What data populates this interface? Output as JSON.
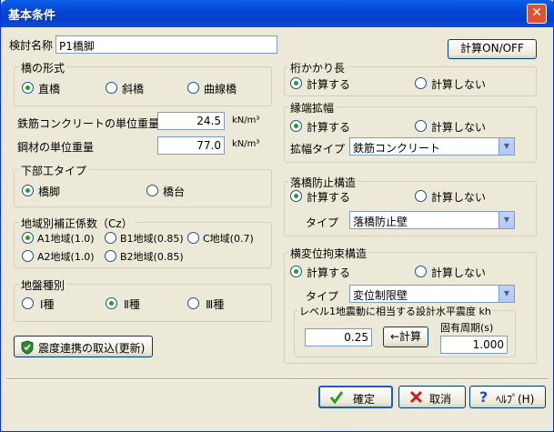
{
  "window": {
    "title": "基本条件",
    "close_glyph": "✕"
  },
  "kentou": {
    "label": "検討名称",
    "value": "P1橋脚"
  },
  "calc_toggle_button": "計算ON/OFF",
  "bridge_form": {
    "title": "橋の形式",
    "options": [
      {
        "label": "直橋",
        "selected": true
      },
      {
        "label": "斜橋",
        "selected": false
      },
      {
        "label": "曲線橋",
        "selected": false
      }
    ]
  },
  "rebar_concrete_weight": {
    "label": "鉄筋コンクリートの単位重量",
    "value": "24.5",
    "unit": "kN/m³"
  },
  "steel_weight": {
    "label": "鋼材の単位重量",
    "value": "77.0",
    "unit": "kN/m³"
  },
  "substructure": {
    "title": "下部工タイプ",
    "options": [
      {
        "label": "橋脚",
        "selected": true
      },
      {
        "label": "橋台",
        "selected": false
      }
    ]
  },
  "regional_coeff": {
    "title": "地域別補正係数（Cz）",
    "options": [
      {
        "label": "A1地域(1.0)",
        "selected": true
      },
      {
        "label": "B1地域(0.85)",
        "selected": false
      },
      {
        "label": "C地域(0.7)",
        "selected": false
      },
      {
        "label": "A2地域(1.0)",
        "selected": false
      },
      {
        "label": "B2地域(0.85)",
        "selected": false
      }
    ]
  },
  "ground_type": {
    "title": "地盤種別",
    "options": [
      {
        "label": "Ⅰ種",
        "selected": false
      },
      {
        "label": "Ⅱ種",
        "selected": true
      },
      {
        "label": "Ⅲ種",
        "selected": false
      }
    ]
  },
  "import_button": {
    "label": "震度連携の取込(更新)",
    "icon": "shield-icon",
    "icon_color": "#2e8b2e"
  },
  "girder_seat": {
    "title": "桁かかり長",
    "options": [
      {
        "label": "計算する",
        "selected": true
      },
      {
        "label": "計算しない",
        "selected": false
      }
    ]
  },
  "edge_widening": {
    "title": "縁端拡幅",
    "options": [
      {
        "label": "計算する",
        "selected": true
      },
      {
        "label": "計算しない",
        "selected": false
      }
    ],
    "type_label": "拡幅タイプ",
    "type_value": "鉄筋コンクリート"
  },
  "fall_prevention": {
    "title": "落橋防止構造",
    "options": [
      {
        "label": "計算する",
        "selected": true
      },
      {
        "label": "計算しない",
        "selected": false
      }
    ],
    "type_label": "タイプ",
    "type_value": "落橋防止壁"
  },
  "lateral_restraint": {
    "title": "横変位拘束構造",
    "options": [
      {
        "label": "計算する",
        "selected": true
      },
      {
        "label": "計算しない",
        "selected": false
      }
    ],
    "type_label": "タイプ",
    "type_value": "変位制限壁",
    "seismic": {
      "title": "レベル1地震動に相当する設計水平震度 kh",
      "kh_value": "0.25",
      "calc_button": "←計算",
      "period_label": "固有周期(s)",
      "period_value": "1.000"
    }
  },
  "footer": {
    "ok": "確定",
    "cancel": "取消",
    "help": "ﾍﾙﾌﾟ(H)",
    "ok_icon_color": "#2e9a2e",
    "cancel_icon_color": "#c82020",
    "help_icon_color": "#2050c0"
  }
}
